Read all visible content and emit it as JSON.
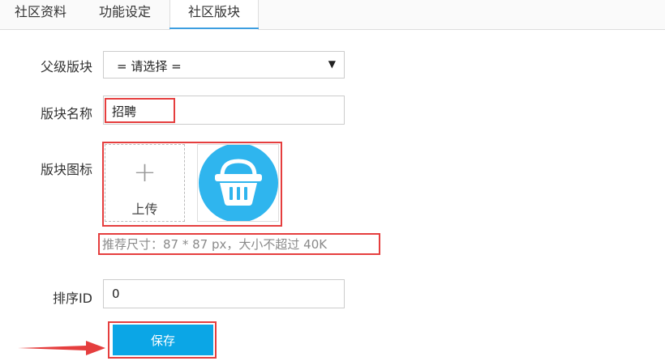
{
  "tabs": [
    {
      "label": "社区资料"
    },
    {
      "label": "功能设定"
    },
    {
      "label": "社区版块"
    }
  ],
  "form": {
    "parent_label": "父级版块",
    "parent_value": "= 请选择 =",
    "name_label": "版块名称",
    "name_value": "招聘",
    "icon_label": "版块图标",
    "upload_text": "上传",
    "hint": "推荐尺寸：87 * 87 px，大小不超过 40K",
    "sort_label": "排序ID",
    "sort_value": "0",
    "save_label": "保存"
  },
  "colors": {
    "accent": "#0ba6e6",
    "icon_bg": "#2fb5ee",
    "highlight": "#e53e3e"
  },
  "icons": {
    "upload": "plus-icon",
    "thumb": "basket-icon",
    "dropdown": "caret-down-icon",
    "annotation": "arrow-right-icon"
  }
}
